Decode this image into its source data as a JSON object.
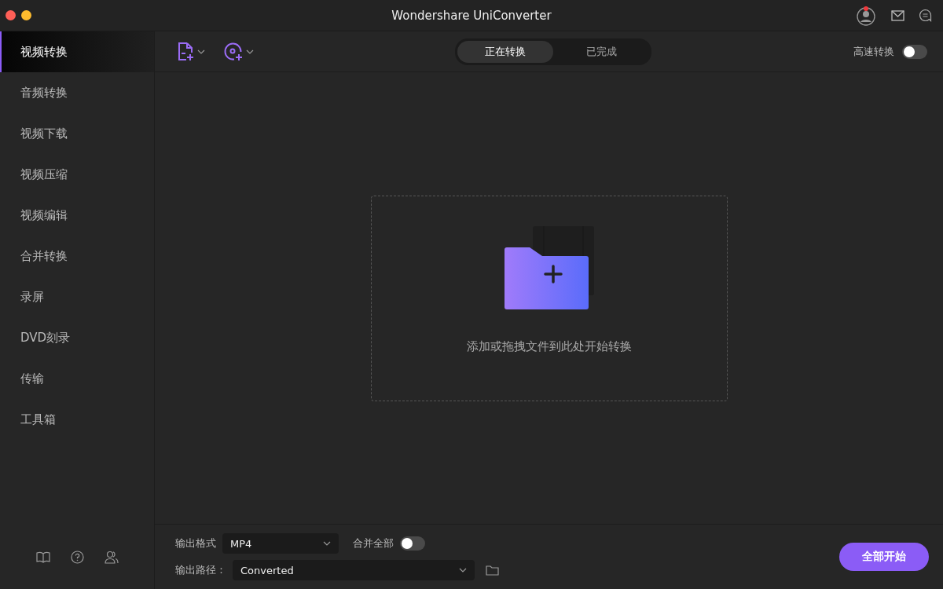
{
  "window": {
    "title": "Wondershare UniConverter",
    "has_notification": true
  },
  "sidebar": {
    "items": [
      {
        "label": "视频转换",
        "selected": true
      },
      {
        "label": "音频转换",
        "selected": false
      },
      {
        "label": "视频下载",
        "selected": false
      },
      {
        "label": "视频压缩",
        "selected": false
      },
      {
        "label": "视频编辑",
        "selected": false
      },
      {
        "label": "合并转换",
        "selected": false
      },
      {
        "label": "录屏",
        "selected": false
      },
      {
        "label": "DVD刻录",
        "selected": false
      },
      {
        "label": "传输",
        "selected": false
      },
      {
        "label": "工具箱",
        "selected": false
      }
    ]
  },
  "tabs": [
    {
      "label": "正在转换",
      "selected": true
    },
    {
      "label": "已完成",
      "selected": false
    }
  ],
  "high_speed": {
    "label": "高速转换",
    "on": false
  },
  "drop_zone": {
    "hint": "添加或拖拽文件到此处开始转换"
  },
  "output": {
    "format_label": "输出格式",
    "format": "MP4",
    "merge_label": "合并全部",
    "merge_on": false,
    "path_label": "输出路径：",
    "path": "Converted"
  },
  "start_button": "全部开始"
}
